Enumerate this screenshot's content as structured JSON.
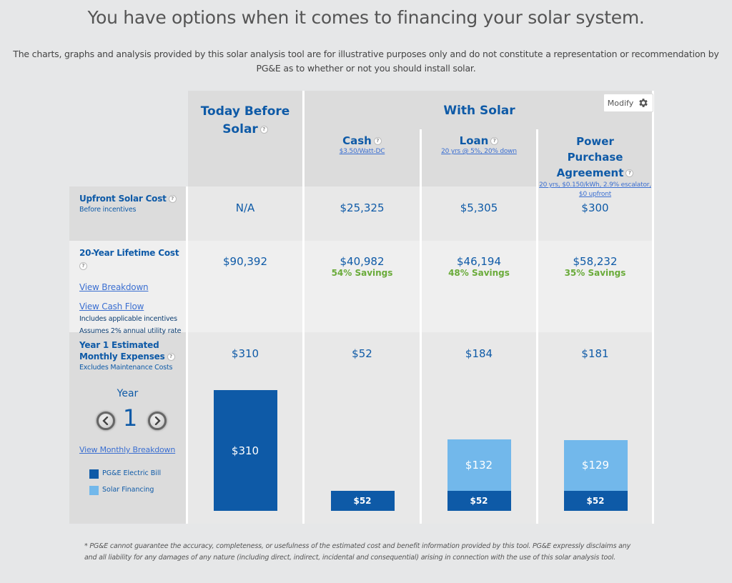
{
  "page": {
    "title": "You have options when it comes to financing your solar system.",
    "disclaimer": "The charts, graphs and analysis provided by this solar analysis tool are for illustrative purposes only and do not constitute a representation or recommendation by PG&E as to whether or not you should install solar.",
    "footnote": "* PG&E cannot guarantee the accuracy, completeness, or usefulness of the estimated cost and benefit information provided by this tool. PG&E expressly disclaims any and all liability for any damages of any nature (including direct, indirect, incidental and consequential) arising in connection with the use of this solar analysis tool."
  },
  "header": {
    "today_title": "Today Before Solar",
    "with_solar_title": "With Solar",
    "modify_label": "Modify",
    "help_glyph": "?",
    "options": [
      {
        "title": "Cash",
        "sub": "$3.50/Watt-DC"
      },
      {
        "title": "Loan",
        "sub": "20 yrs @ 5%, 20% down"
      },
      {
        "title": "Power Purchase Agreement",
        "sub": "20 yrs, $0.150/kWh, 2.9% escalator, $0 upfront"
      }
    ]
  },
  "rows": {
    "upfront": {
      "label": "Upfront Solar Cost",
      "sub": "Before incentives",
      "values": [
        "N/A",
        "$25,325",
        "$5,305",
        "$300"
      ]
    },
    "lifetime": {
      "label": "20-Year Lifetime Cost",
      "links": [
        "View Breakdown",
        "View Cash Flow"
      ],
      "notes": [
        "Includes applicable incentives",
        "Assumes 2% annual utility rate"
      ],
      "values": [
        "$90,392",
        "$40,982",
        "$46,194",
        "$58,232"
      ],
      "savings": [
        "",
        "54% Savings",
        "48% Savings",
        "35% Savings"
      ]
    },
    "monthly": {
      "label_line1": "Year 1 Estimated",
      "label_line2": "Monthly Expenses",
      "sub": "Excludes Maintenance Costs",
      "year_label": "Year",
      "year_value": "1",
      "breakdown_link": "View Monthly Breakdown",
      "values": [
        "$310",
        "$52",
        "$184",
        "$181"
      ]
    }
  },
  "legend": [
    {
      "label": "PG&E Electric Bill",
      "color": "#0e5aa7"
    },
    {
      "label": "Solar Financing",
      "color": "#72b8eb"
    }
  ],
  "chart_data": {
    "type": "bar",
    "stacked": true,
    "title": "Year 1 Estimated Monthly Expenses",
    "categories": [
      "Today Before Solar",
      "Cash",
      "Loan",
      "Power Purchase Agreement"
    ],
    "series": [
      {
        "name": "PG&E Electric Bill",
        "color": "#0e5aa7",
        "values": [
          310,
          52,
          52,
          52
        ],
        "labels": [
          "$310",
          "$52",
          "$52",
          "$52"
        ]
      },
      {
        "name": "Solar Financing",
        "color": "#72b8eb",
        "values": [
          0,
          0,
          132,
          129
        ],
        "labels": [
          "",
          "",
          "$132",
          "$129"
        ]
      }
    ],
    "ylim": [
      0,
      310
    ],
    "legend": "left"
  }
}
